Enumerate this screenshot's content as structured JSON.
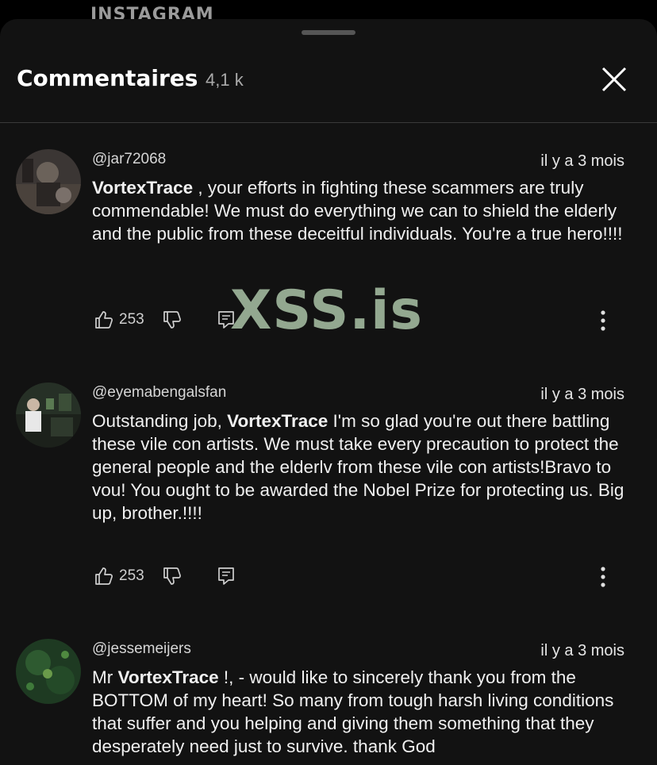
{
  "app": {
    "label": "INSTAGRAM"
  },
  "header": {
    "title": "Commentaires",
    "count": "4,1 k"
  },
  "watermark": "XSS.is",
  "comments": [
    {
      "author": "@jar72068",
      "time": "il y a 3 mois",
      "mention": "VortexTrace",
      "text": " , your efforts in fighting these scammers are truly commendable! We must do everything we can to shield the elderly and the public from these deceitful individuals. You're a true hero!!!!",
      "likes": "253"
    },
    {
      "author": "@eyemabengalsfan",
      "time": "il y a 3 mois",
      "prefix": "Outstanding job, ",
      "mention": "VortexTrace",
      "text": " I'm so glad you're out there battling these vile con artists. We must take every precaution to protect the general people and the elderlv from these vile con artists!Bravo to vou! You ought to be awarded the Nobel Prize for protecting us. Big up, brother.!!!!",
      "likes": "253"
    },
    {
      "author": "@jessemeijers",
      "time": "il y a 3 mois",
      "prefix": "Mr ",
      "mention": "VortexTrace",
      "text": " !, - would like to sincerely thank you from the BOTTOM of my heart! So many from tough harsh living conditions that suffer and you helping and giving them something that they desperately need just to survive. thank God"
    }
  ]
}
